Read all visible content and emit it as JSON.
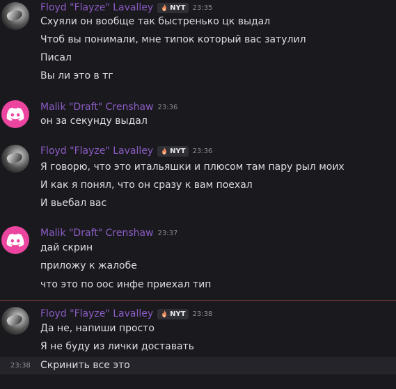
{
  "messages": [
    {
      "author": "Floyd \"Flayze\" Lavalley",
      "avatar": "photo",
      "badge": {
        "icon": "fire-emoji-icon",
        "tag": "NYT"
      },
      "time": "23:35",
      "lines": [
        "Схуяли он вообще так быстренько цк выдал",
        "Чтоб вы понимали, мне типок который вас затулил",
        "Писал",
        "Вы ли это в тг"
      ]
    },
    {
      "author": "Malik \"Draft\" Crenshaw",
      "avatar": "discord-logo",
      "time": "23:36",
      "lines": [
        "он за секунду выдал"
      ]
    },
    {
      "author": "Floyd \"Flayze\" Lavalley",
      "avatar": "photo",
      "badge": {
        "icon": "fire-emoji-icon",
        "tag": "NYT"
      },
      "time": "23:36",
      "lines": [
        "Я говорю, что это итальяшки и плюсом там пару рыл моих",
        "И как я понял, что он сразу к вам поехал",
        "И вьебал вас"
      ]
    },
    {
      "author": "Malik \"Draft\" Crenshaw",
      "avatar": "discord-logo",
      "time": "23:37",
      "lines": [
        "дай скрин",
        "приложу к жалобе",
        "что это по оос инфе приехал тип"
      ]
    },
    {
      "author": "Floyd \"Flayze\" Lavalley",
      "avatar": "photo",
      "badge": {
        "icon": "fire-emoji-icon",
        "tag": "NYT"
      },
      "time": "23:38",
      "lines": [
        "Да не, напиши просто",
        "Я не буду из лички доставать",
        "Скринить все это"
      ],
      "hover_time": "23:38"
    }
  ],
  "colors": {
    "background": "#1a1a1e",
    "author_name": "#8b5bc4",
    "text": "#dcdde2",
    "timestamp": "#8d8f97",
    "discord_avatar": "#eb459f",
    "new_divider": "#7a3a3a"
  }
}
